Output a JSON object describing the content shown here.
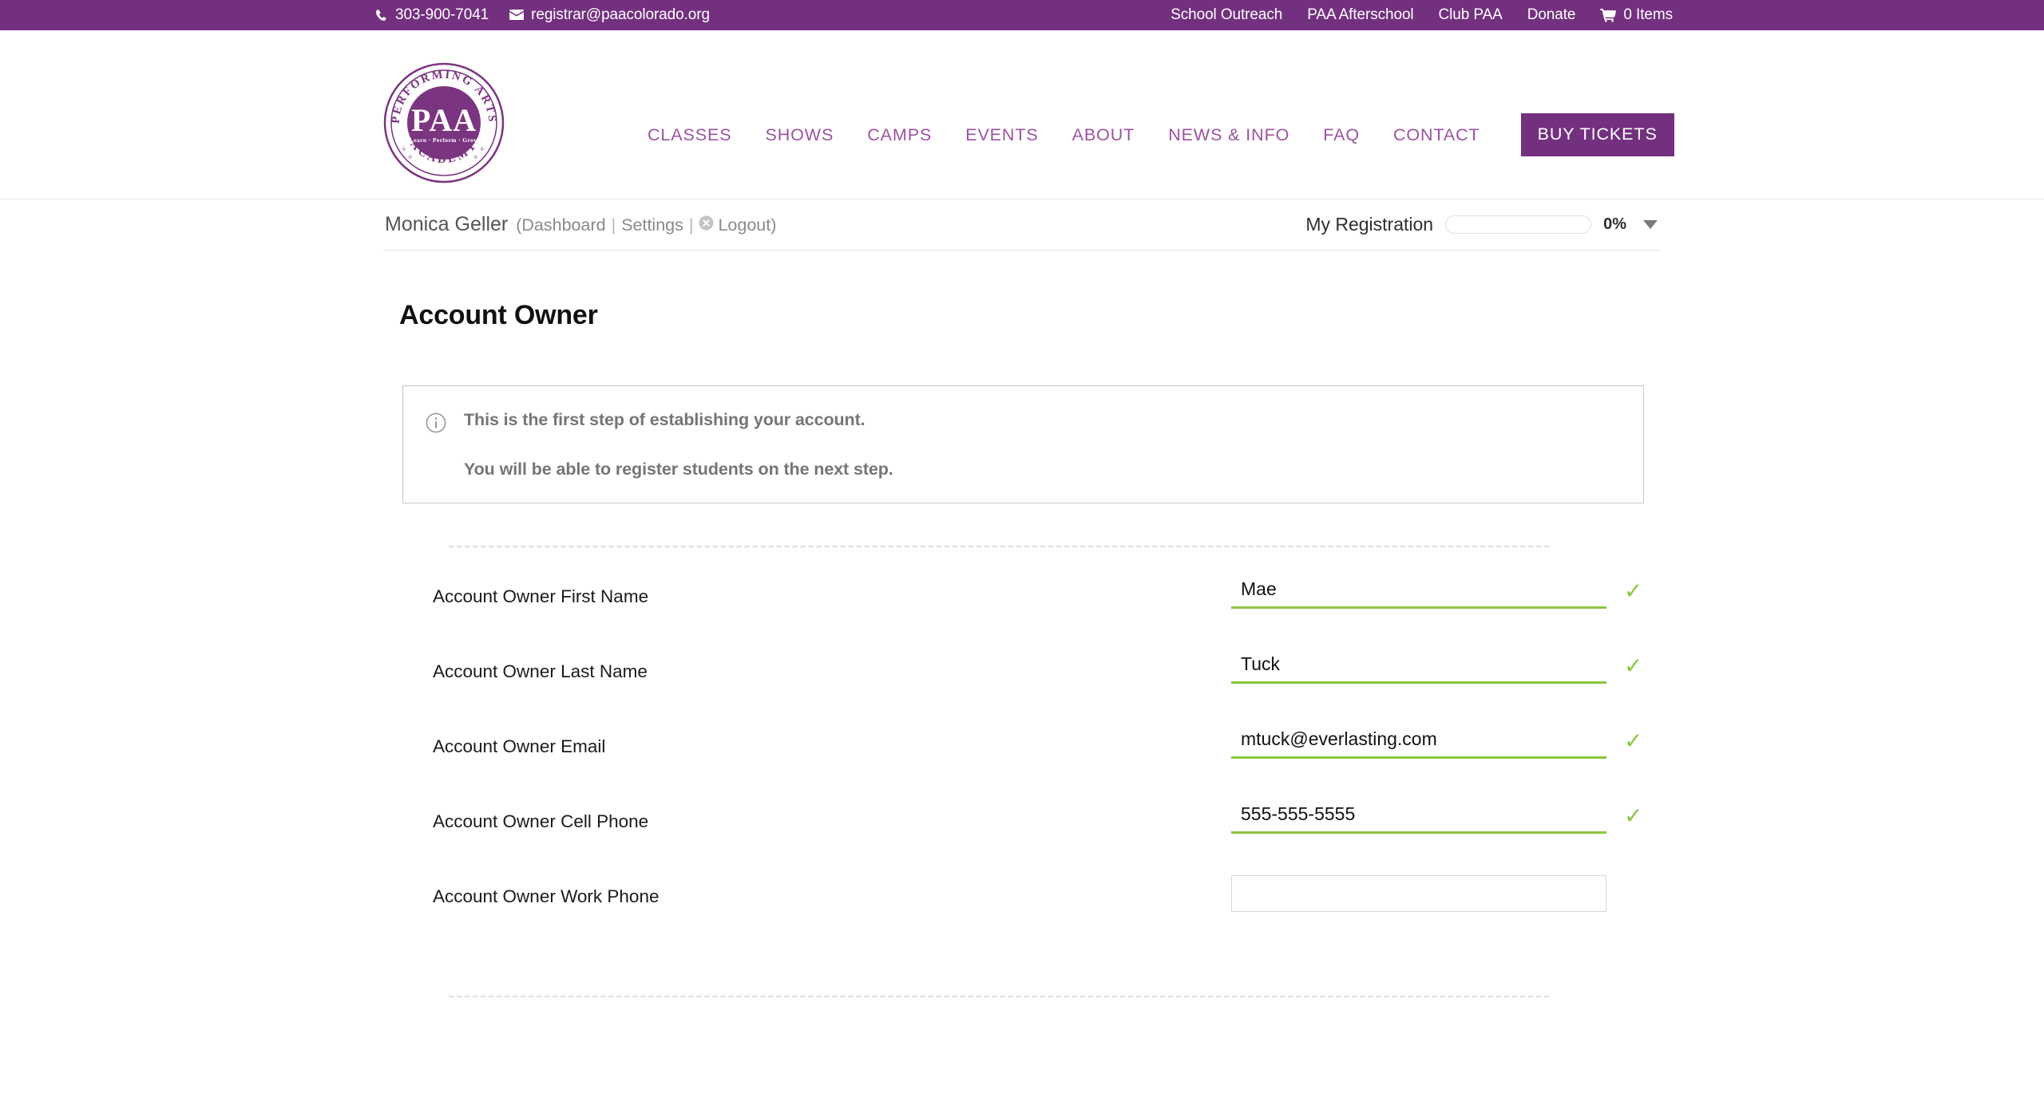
{
  "topbar": {
    "phone": "303-900-7041",
    "phone_icon": "phone-icon",
    "email": "registrar@paacolorado.org",
    "email_icon": "envelope-icon",
    "links": [
      {
        "label": "School Outreach"
      },
      {
        "label": "PAA Afterschool"
      },
      {
        "label": "Club PAA"
      },
      {
        "label": "Donate"
      }
    ],
    "cart": {
      "icon": "cart-icon",
      "label": "0 Items"
    },
    "background_color": "#73307F"
  },
  "logo": {
    "arc_top": "PERFORMING ARTS",
    "arc_bottom": "ACADEMY",
    "center": "PAA",
    "tagline": "Learn · Perform · Grow",
    "color": "#7B3580"
  },
  "mainnav": {
    "items": [
      {
        "label": "CLASSES"
      },
      {
        "label": "SHOWS"
      },
      {
        "label": "CAMPS"
      },
      {
        "label": "EVENTS"
      },
      {
        "label": "ABOUT"
      },
      {
        "label": "NEWS & INFO"
      },
      {
        "label": "FAQ"
      },
      {
        "label": "CONTACT"
      }
    ],
    "cta": {
      "label": "BUY TICKETS",
      "background_color": "#73307F"
    },
    "link_color": "#9B529F"
  },
  "userbar": {
    "name": "Monica Geller",
    "open_paren": "(",
    "dashboard": "Dashboard",
    "settings": "Settings",
    "logout": "Logout",
    "logout_icon": "logout-circle-icon",
    "close_paren": ")",
    "separator": "|",
    "registration_label": "My Registration",
    "progress_percent": "0%",
    "progress_value": 0,
    "dropdown_icon": "chevron-down-icon"
  },
  "main": {
    "page_title": "Account Owner",
    "info_box": {
      "icon": "info-circle-icon",
      "lines": [
        "This is the first step of establishing your account.",
        "You will be able to register students on the next step."
      ]
    },
    "fields": [
      {
        "label": "Account Owner First Name",
        "value": "Mae",
        "placeholder": "",
        "style": "underline",
        "valid": true,
        "valid_icon": "check-icon"
      },
      {
        "label": "Account Owner Last Name",
        "value": "Tuck",
        "placeholder": "",
        "style": "underline",
        "valid": true,
        "valid_icon": "check-icon"
      },
      {
        "label": "Account Owner Email",
        "value": "mtuck@everlasting.com",
        "placeholder": "",
        "style": "underline",
        "valid": true,
        "valid_icon": "check-icon"
      },
      {
        "label": "Account Owner Cell Phone",
        "value": "555-555-5555",
        "placeholder": "",
        "style": "underline",
        "valid": true,
        "valid_icon": "check-icon"
      },
      {
        "label": "Account Owner Work Phone",
        "value": "",
        "placeholder": "",
        "style": "boxed",
        "valid": false,
        "valid_icon": ""
      }
    ],
    "check_color": "#8CC63E"
  }
}
